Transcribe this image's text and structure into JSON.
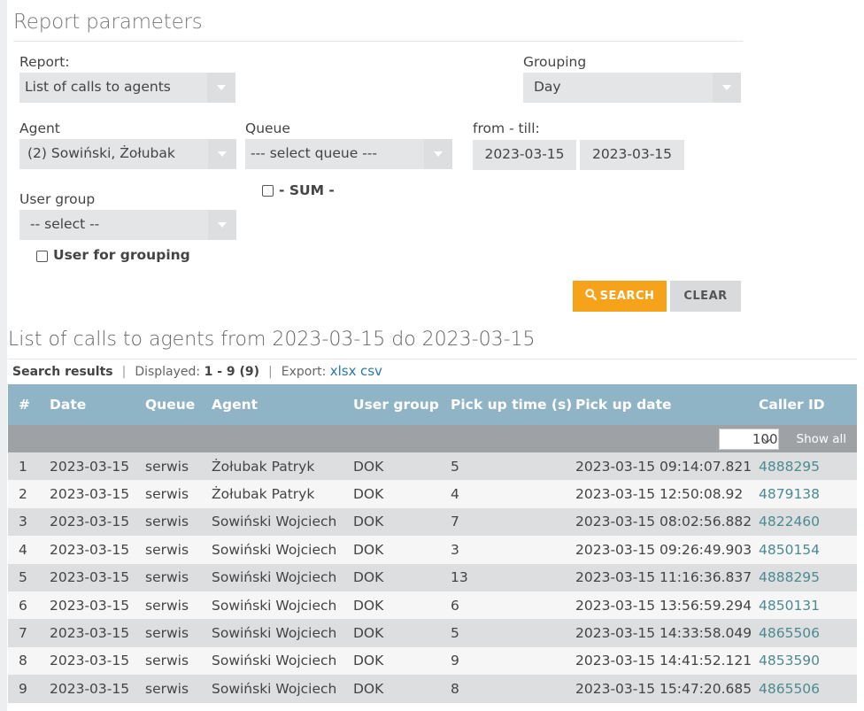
{
  "params": {
    "title": "Report parameters",
    "report_label": "Report:",
    "report_value": "List of calls to agents",
    "grouping_label": "Grouping",
    "grouping_value": "Day",
    "agent_label": "Agent",
    "agent_value": "(2) Sowiński, Żołubak",
    "queue_label": "Queue",
    "queue_value": "--- select queue ---",
    "range_label": "from - till:",
    "date_from": "2023-03-15",
    "date_till": "2023-03-15",
    "sum_label": "- SUM -",
    "usergroup_label": "User group",
    "usergroup_value": "-- select --",
    "user_for_grouping_label": "User for grouping",
    "search_label": "SEARCH",
    "clear_label": "CLEAR"
  },
  "results": {
    "title": "List of calls to agents from 2023-03-15 do 2023-03-15",
    "search_results_label": "Search results",
    "displayed_label": "Displayed:",
    "displayed_value": "1 - 9 (9)",
    "export_label": "Export:",
    "export_xlsx": "xlsx",
    "export_csv": "csv",
    "per_page": "100",
    "show_all": "Show all",
    "columns": [
      "#",
      "Date",
      "Queue",
      "Agent",
      "User group",
      "Pick up time (s)",
      "Pick up date",
      "Caller ID"
    ],
    "rows": [
      [
        "1",
        "2023-03-15",
        "serwis",
        "Żołubak Patryk",
        "DOK",
        "5",
        "2023-03-15 09:14:07.821",
        "4888295"
      ],
      [
        "2",
        "2023-03-15",
        "serwis",
        "Żołubak Patryk",
        "DOK",
        "4",
        "2023-03-15 12:50:08.92",
        "4879138"
      ],
      [
        "3",
        "2023-03-15",
        "serwis",
        "Sowiński Wojciech",
        "DOK",
        "7",
        "2023-03-15 08:02:56.882",
        "4822460"
      ],
      [
        "4",
        "2023-03-15",
        "serwis",
        "Sowiński Wojciech",
        "DOK",
        "3",
        "2023-03-15 09:26:49.903",
        "4850154"
      ],
      [
        "5",
        "2023-03-15",
        "serwis",
        "Sowiński Wojciech",
        "DOK",
        "13",
        "2023-03-15 11:16:36.837",
        "4888295"
      ],
      [
        "6",
        "2023-03-15",
        "serwis",
        "Sowiński Wojciech",
        "DOK",
        "6",
        "2023-03-15 13:56:59.294",
        "4850131"
      ],
      [
        "7",
        "2023-03-15",
        "serwis",
        "Sowiński Wojciech",
        "DOK",
        "5",
        "2023-03-15 14:33:58.049",
        "4865506"
      ],
      [
        "8",
        "2023-03-15",
        "serwis",
        "Sowiński Wojciech",
        "DOK",
        "9",
        "2023-03-15 14:41:52.121",
        "4853590"
      ],
      [
        "9",
        "2023-03-15",
        "serwis",
        "Sowiński Wojciech",
        "DOK",
        "8",
        "2023-03-15 15:47:20.685",
        "4865506"
      ]
    ]
  },
  "colors": {
    "accent": "#f7a21b",
    "table_header": "#8fb4c6",
    "link": "#2a78a8",
    "caller_id": "#4d8a91"
  },
  "icons": {
    "search_button_icon": "search-icon"
  }
}
